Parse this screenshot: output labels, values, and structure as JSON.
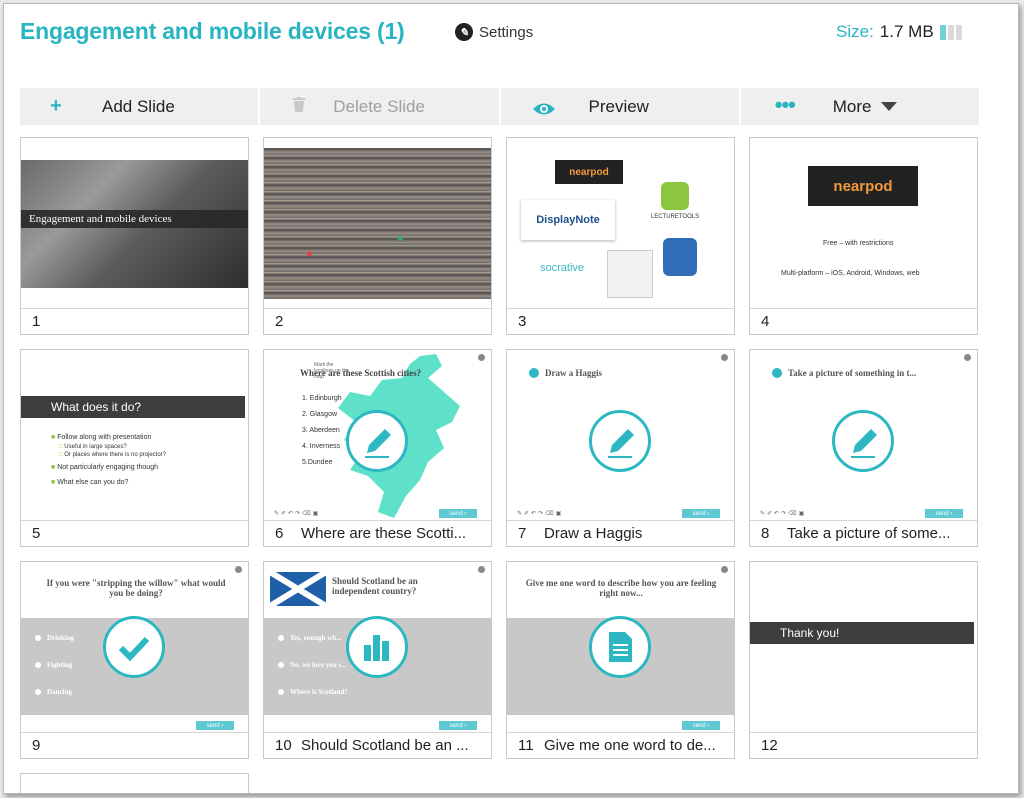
{
  "header": {
    "title": "Engagement and mobile devices (1)",
    "settings_label": "Settings",
    "size_label": "Size:",
    "size_value": "1.7 MB"
  },
  "toolbar": {
    "add_slide": "Add Slide",
    "delete_slide": "Delete Slide",
    "preview": "Preview",
    "more": "More"
  },
  "colors": {
    "accent": "#28b4c0",
    "dark_bar": "#3d3d3d",
    "teal_button": "#5ec9d2"
  },
  "slides": [
    {
      "num": "1",
      "title": "",
      "thumb_text": "Engagement and mobile devices"
    },
    {
      "num": "2",
      "title": ""
    },
    {
      "num": "3",
      "title": "",
      "logos": [
        "nearpod",
        "DisplayNote",
        "LECTURETOOLS",
        "socrative"
      ]
    },
    {
      "num": "4",
      "title": "",
      "logo": "nearpod",
      "line1": "Free – with restrictions",
      "line2": "Multi-platform – iOS, Android, Windows, web"
    },
    {
      "num": "5",
      "title": "",
      "heading": "What does it do?",
      "bullets": [
        "Follow along with presentation",
        "Useful in large spaces?",
        "Or places where there is no projector?",
        "Not particularly engaging though",
        "What else can you do?"
      ]
    },
    {
      "num": "6",
      "title": "Where are these Scotti...",
      "question": "Where are these Scottish cities?",
      "prompt": "Mark the locations on the map",
      "cities": [
        "1. Edinburgh",
        "2. Glasgow",
        "3. Aberdeen",
        "4. Inverness",
        "5.Dundee"
      ],
      "send": "send"
    },
    {
      "num": "7",
      "title": "Draw a Haggis",
      "question": "Draw a Haggis",
      "send": "send"
    },
    {
      "num": "8",
      "title": "Take a picture of some...",
      "question": "Take a picture of something in t...",
      "send": "send"
    },
    {
      "num": "9",
      "title": "",
      "question": "If you were \"stripping the willow\" what would you be doing?",
      "options": [
        "Drinking",
        "Fighting",
        "Dancing"
      ],
      "send": "send"
    },
    {
      "num": "10",
      "title": "Should Scotland be an ...",
      "question": "Should Scotland be an independent country?",
      "options": [
        "Yes, enough wh...",
        "No, we love you s...",
        "Where is Scotland?"
      ],
      "send": "send"
    },
    {
      "num": "11",
      "title": "Give me one word to de...",
      "question": "Give me one word to describe how you are feeling right now...",
      "send": "send"
    },
    {
      "num": "12",
      "title": "",
      "heading": "Thank you!"
    }
  ]
}
